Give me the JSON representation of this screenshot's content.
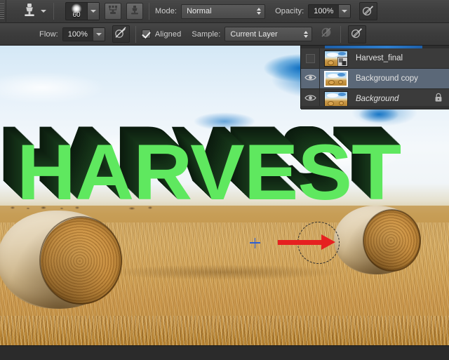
{
  "app": {
    "title": "Photoshop Clone Stamp Tool"
  },
  "options_bar_row1": {
    "grip": "tool-options-grip",
    "tool_icon": "clone-stamp-icon",
    "tool_preset_caret": "chevron-down-icon",
    "brush_size": "60",
    "brush_dropdown": "chevron-down-icon",
    "toggle_brush_panel_icon": "brush-panel-icon",
    "toggle_clone_source_icon": "clone-source-panel-icon",
    "mode_label": "Mode:",
    "mode_value": "Normal",
    "opacity_label": "Opacity:",
    "opacity_value": "100%",
    "airbrush_icon": "airbrush-icon"
  },
  "options_bar_row2": {
    "flow_label": "Flow:",
    "flow_value": "100%",
    "pressure_size_icon": "pressure-for-size-icon",
    "aligned_label": "Aligned",
    "aligned_checked": true,
    "sample_label": "Sample:",
    "sample_value": "Current Layer",
    "ignore_adjustment_icon": "ignore-adjustment-layers-icon",
    "pressure_opacity_icon": "pressure-for-opacity-icon"
  },
  "canvas": {
    "artwork_text": "HARVEST",
    "text_face_color": "#5fe85f",
    "text_extrude_color": "#0d2810",
    "annotation_arrow_color": "#e62020",
    "clone_source_marker": "crosshair-marker",
    "brush_cursor": "brush-cursor-ring",
    "scene": {
      "sky": "cloudy-blue-sky",
      "field": "golden-stubble-field",
      "bale_left": "round-hay-bale",
      "bale_right": "round-hay-bale"
    }
  },
  "layers_panel": {
    "title": "layers-panel",
    "layers": [
      {
        "name": "Harvest_final",
        "visible": false,
        "selected": false,
        "locked": false,
        "italic": false,
        "has_smart_badge": true
      },
      {
        "name": "Background copy",
        "visible": true,
        "selected": true,
        "locked": false,
        "italic": false,
        "has_smart_badge": false
      },
      {
        "name": "Background",
        "visible": true,
        "selected": false,
        "locked": true,
        "italic": true,
        "has_smart_badge": false
      }
    ],
    "eye_icon": "eye-icon",
    "lock_icon": "lock-icon"
  }
}
